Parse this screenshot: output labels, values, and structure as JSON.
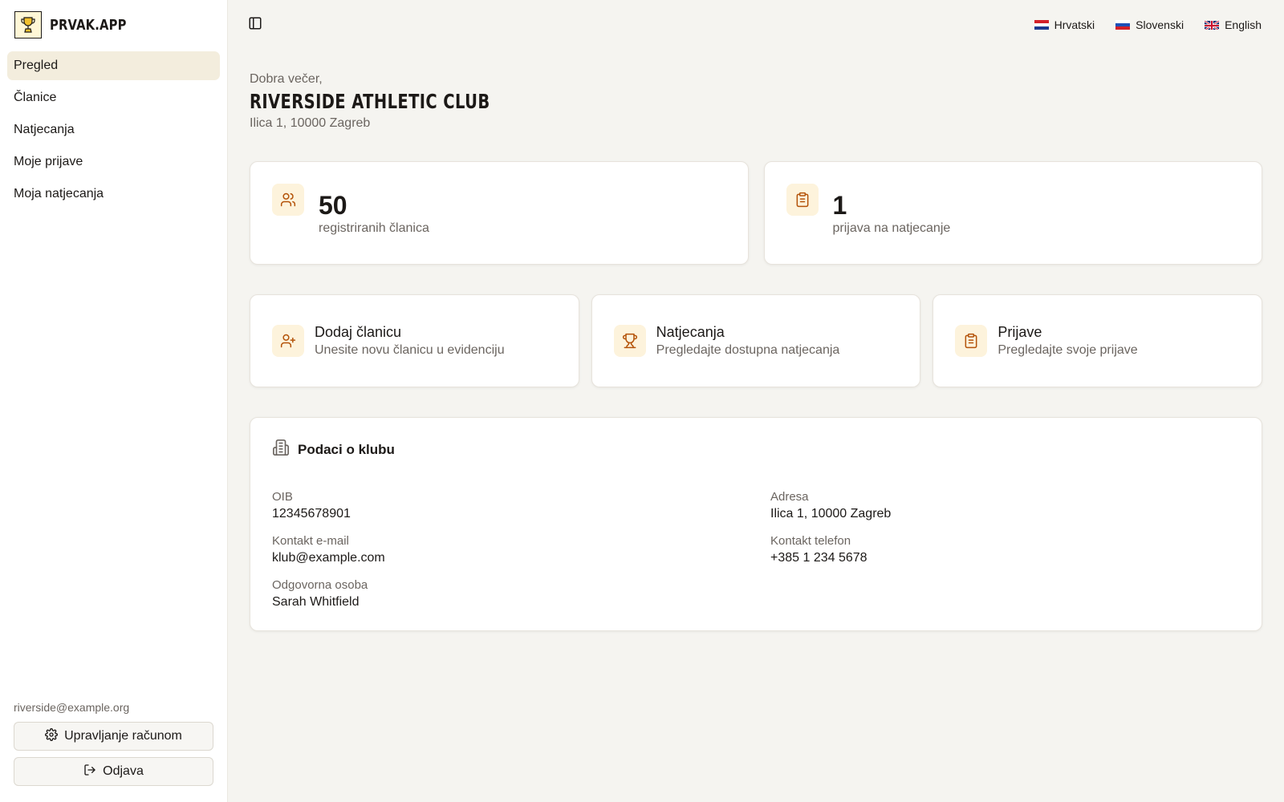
{
  "brand": {
    "name": "PRVAK.APP"
  },
  "sidebar": {
    "items": [
      {
        "label": "Pregled",
        "active": true
      },
      {
        "label": "Članice"
      },
      {
        "label": "Natjecanja"
      },
      {
        "label": "Moje prijave"
      },
      {
        "label": "Moja natjecanja"
      }
    ],
    "email": "riverside@example.org",
    "manage_label": "Upravljanje računom",
    "logout_label": "Odjava"
  },
  "languages": [
    "Hrvatski",
    "Slovenski",
    "English"
  ],
  "header": {
    "greeting": "Dobra večer,",
    "club_name": "RIVERSIDE ATHLETIC CLUB",
    "address": "Ilica 1, 10000 Zagreb"
  },
  "stats": [
    {
      "value": "50",
      "label": "registriranih članica",
      "icon": "users-icon"
    },
    {
      "value": "1",
      "label": "prijava na natjecanje",
      "icon": "clipboard-icon"
    }
  ],
  "actions": [
    {
      "title": "Dodaj članicu",
      "desc": "Unesite novu članicu u evidenciju",
      "icon": "user-plus-icon"
    },
    {
      "title": "Natjecanja",
      "desc": "Pregledajte dostupna natjecanja",
      "icon": "trophy-icon"
    },
    {
      "title": "Prijave",
      "desc": "Pregledajte svoje prijave",
      "icon": "clipboard-icon"
    }
  ],
  "club_info": {
    "title": "Podaci o klubu",
    "oib": {
      "label": "OIB",
      "value": "12345678901"
    },
    "address": {
      "label": "Adresa",
      "value": "Ilica 1, 10000 Zagreb"
    },
    "email": {
      "label": "Kontakt e-mail",
      "value": "klub@example.com"
    },
    "phone": {
      "label": "Kontakt telefon",
      "value": "+385 1 234 5678"
    },
    "person": {
      "label": "Odgovorna osoba",
      "value": "Sarah Whitfield"
    }
  },
  "colors": {
    "accent": "#b45309",
    "accent_bg": "#fdf3dc",
    "active_nav": "#f3eddd",
    "page_bg": "#f5f4f0"
  }
}
